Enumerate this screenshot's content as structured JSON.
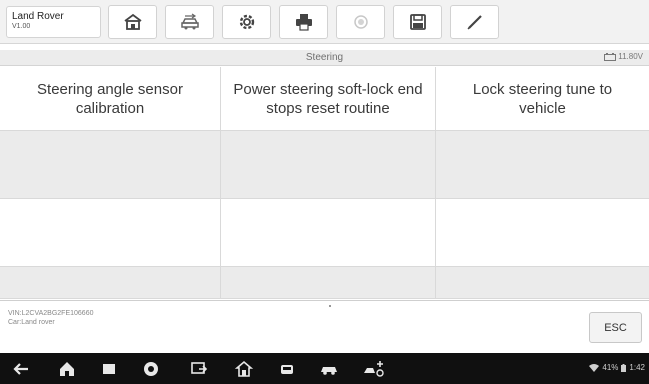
{
  "app": {
    "vehicle": "Land Rover",
    "version": "V1.00"
  },
  "toolbar": {
    "buttons": [
      {
        "icon": "home-icon"
      },
      {
        "icon": "vehicle-swap-icon"
      },
      {
        "icon": "settings-gear-icon"
      },
      {
        "icon": "print-icon"
      },
      {
        "icon": "record-icon",
        "disabled": true
      },
      {
        "icon": "save-icon"
      },
      {
        "icon": "edit-pen-icon"
      }
    ]
  },
  "status": {
    "title": "Steering",
    "battery": "11.80V"
  },
  "functions": [
    {
      "label": "Steering angle sensor calibration"
    },
    {
      "label": "Power steering soft-lock end stops reset routine"
    },
    {
      "label": "Lock steering tune to vehicle"
    }
  ],
  "footer": {
    "vin": "VIN:L2CVA2BG2FE106660",
    "car": "Car:Land rover",
    "esc_label": "ESC"
  },
  "system": {
    "battery_percent": "41%",
    "time": "1:42"
  },
  "colors": {
    "toolbar_bg": "#f2f2f2",
    "grid_blank": "#ebebeb",
    "navbar_bg": "#101010"
  }
}
